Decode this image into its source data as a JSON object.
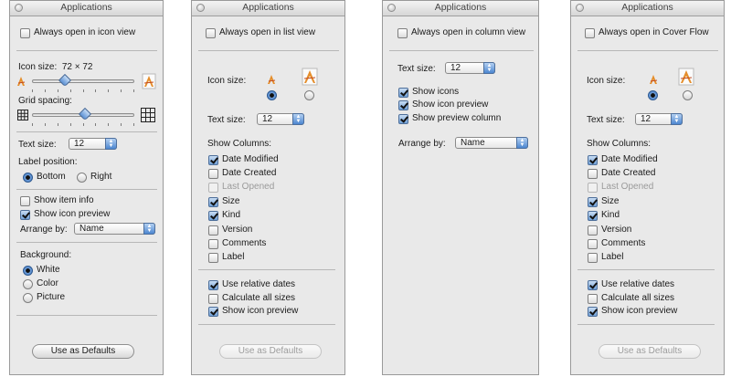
{
  "panels": [
    {
      "title": "Applications",
      "always_open": "Always open in icon view",
      "use_defaults": "Use as Defaults"
    },
    {
      "title": "Applications",
      "always_open": "Always open in list view",
      "use_defaults": "Use as Defaults"
    },
    {
      "title": "Applications",
      "always_open": "Always open in column view"
    },
    {
      "title": "Applications",
      "always_open": "Always open in Cover Flow",
      "use_defaults": "Use as Defaults"
    }
  ],
  "icon_view": {
    "icon_size_label": "Icon size:",
    "icon_size_value": "72 × 72",
    "icon_size_slider": 0.32,
    "grid_spacing_label": "Grid spacing:",
    "grid_spacing_slider": 0.52,
    "text_size_label": "Text size:",
    "text_size_value": "12",
    "label_position_label": "Label position:",
    "bottom": "Bottom",
    "right": "Right",
    "show_item_info": "Show item info",
    "show_icon_preview": "Show icon preview",
    "arrange_by_label": "Arrange by:",
    "arrange_by_value": "Name",
    "background_label": "Background:",
    "white": "White",
    "color": "Color",
    "picture": "Picture"
  },
  "list_view": {
    "icon_size_label": "Icon size:",
    "text_size_label": "Text size:",
    "text_size_value": "12",
    "show_columns_label": "Show Columns:",
    "date_modified": "Date Modified",
    "date_created": "Date Created",
    "last_opened": "Last Opened",
    "size": "Size",
    "kind": "Kind",
    "version": "Version",
    "comments": "Comments",
    "label": "Label",
    "use_relative_dates": "Use relative dates",
    "calculate_all_sizes": "Calculate all sizes",
    "show_icon_preview": "Show icon preview"
  },
  "column_view": {
    "text_size_label": "Text size:",
    "text_size_value": "12",
    "show_icons": "Show icons",
    "show_icon_preview": "Show icon preview",
    "show_preview_column": "Show preview column",
    "arrange_by_label": "Arrange by:",
    "arrange_by_value": "Name"
  },
  "cover_flow": {
    "icon_size_label": "Icon size:",
    "text_size_label": "Text size:",
    "text_size_value": "12",
    "show_columns_label": "Show Columns:",
    "date_modified": "Date Modified",
    "date_created": "Date Created",
    "last_opened": "Last Opened",
    "size": "Size",
    "kind": "Kind",
    "version": "Version",
    "comments": "Comments",
    "label": "Label",
    "use_relative_dates": "Use relative dates",
    "calculate_all_sizes": "Calculate all sizes",
    "show_icon_preview": "Show icon preview"
  },
  "colors": {
    "accent": "#4c86d0",
    "panel_bg": "#e9e9e9"
  }
}
